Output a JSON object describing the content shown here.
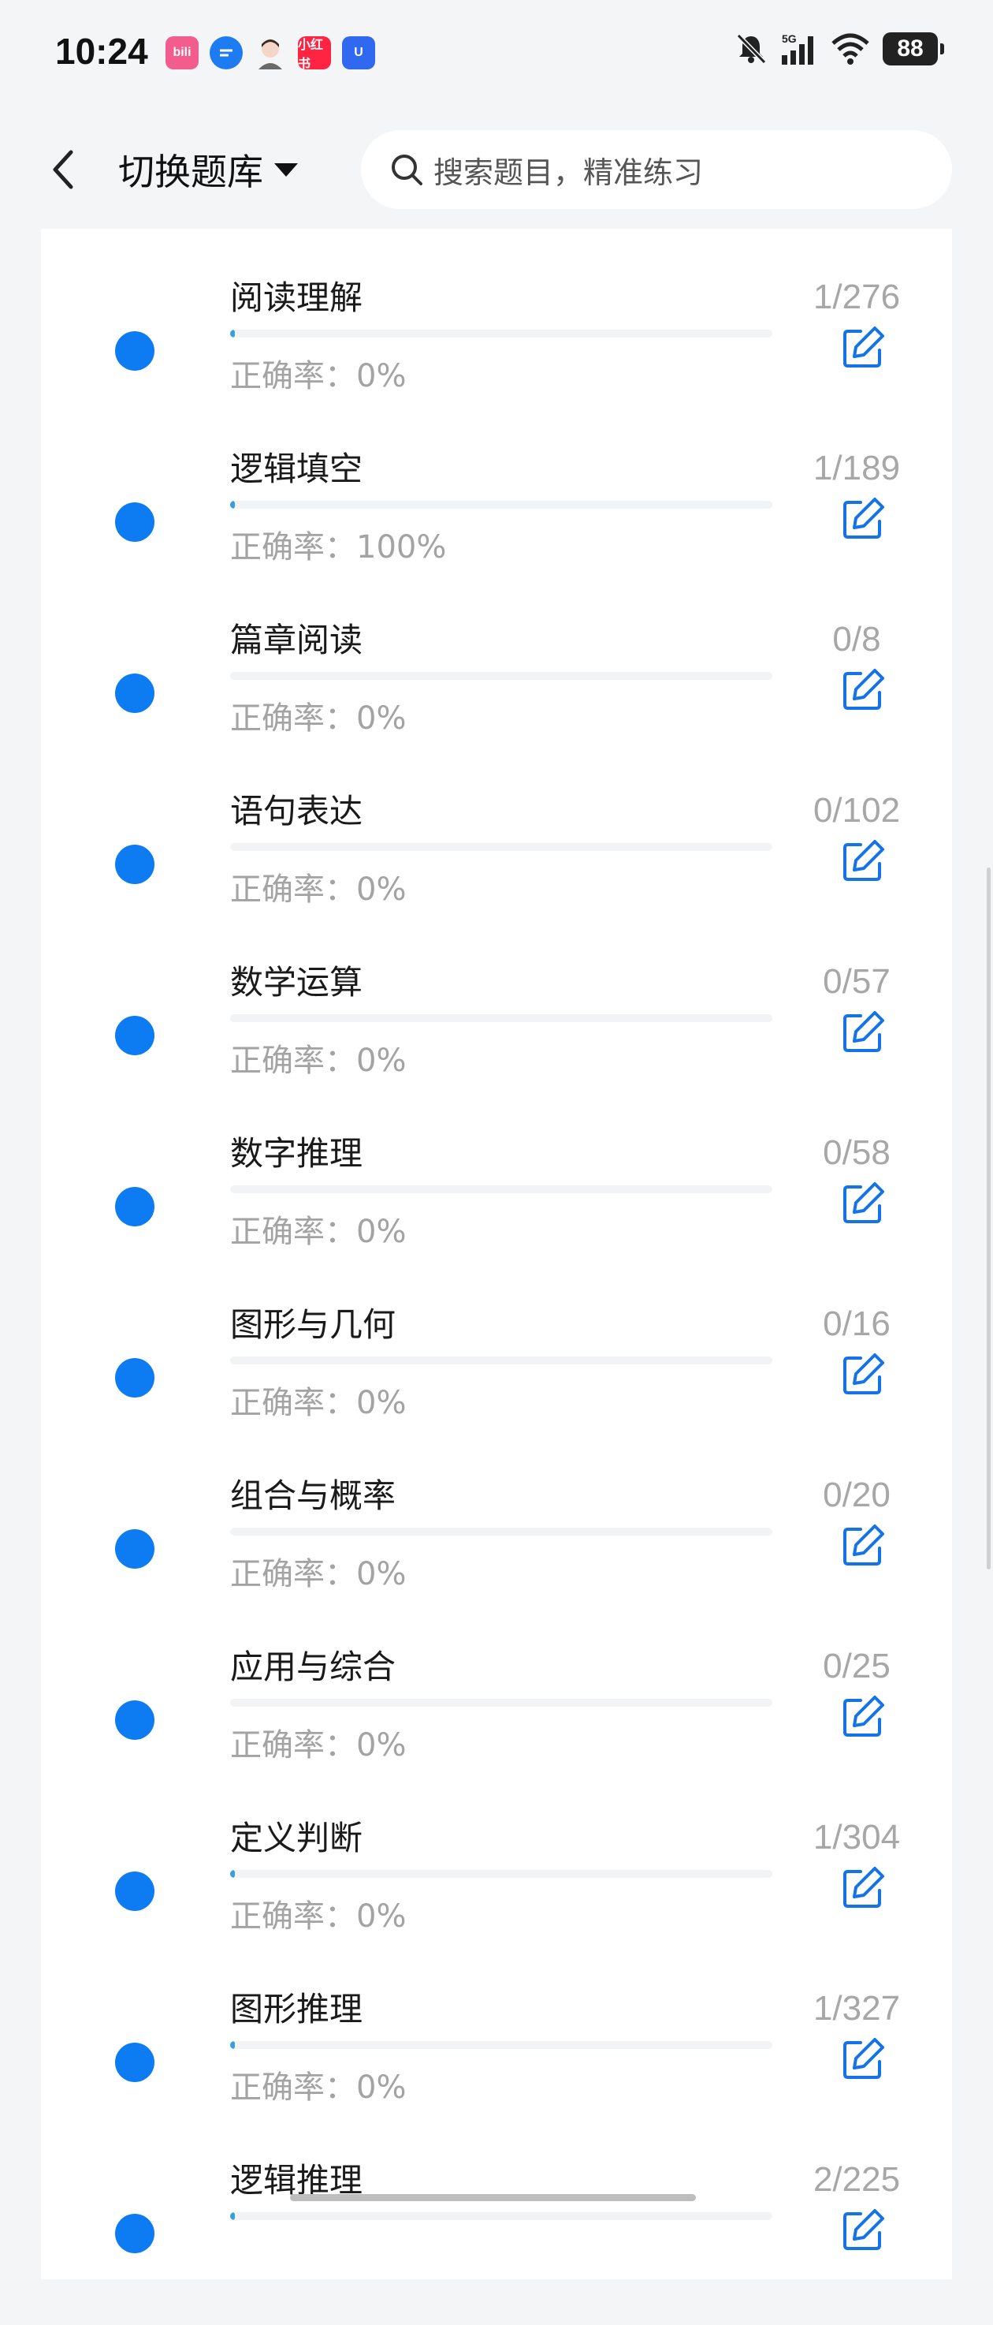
{
  "status_bar": {
    "time": "10:24",
    "apps": [
      {
        "name": "bilibili-icon",
        "label": "bili",
        "color": "#f25d8e"
      },
      {
        "name": "message-icon",
        "label": "",
        "color": "#1e7cf2"
      },
      {
        "name": "avatar-app-icon",
        "label": "",
        "color": "#f4f5f7"
      },
      {
        "name": "xiaohongshu-icon",
        "label": "小红书",
        "color": "#ff2442"
      },
      {
        "name": "vpn-app-icon",
        "label": "U",
        "color": "#3068f0"
      }
    ],
    "network": "5G",
    "battery": "88"
  },
  "header": {
    "title": "切换题库",
    "search_placeholder": "搜索题目，精准练习"
  },
  "categories": [
    {
      "name": "阅读理解",
      "accuracy": "正确率：0%",
      "count": "1/276",
      "progress": 0.0036
    },
    {
      "name": "逻辑填空",
      "accuracy": "正确率：100%",
      "count": "1/189",
      "progress": 0.0053
    },
    {
      "name": "篇章阅读",
      "accuracy": "正确率：0%",
      "count": "0/8",
      "progress": 0
    },
    {
      "name": "语句表达",
      "accuracy": "正确率：0%",
      "count": "0/102",
      "progress": 0
    },
    {
      "name": "数学运算",
      "accuracy": "正确率：0%",
      "count": "0/57",
      "progress": 0
    },
    {
      "name": "数字推理",
      "accuracy": "正确率：0%",
      "count": "0/58",
      "progress": 0
    },
    {
      "name": "图形与几何",
      "accuracy": "正确率：0%",
      "count": "0/16",
      "progress": 0
    },
    {
      "name": "组合与概率",
      "accuracy": "正确率：0%",
      "count": "0/20",
      "progress": 0
    },
    {
      "name": "应用与综合",
      "accuracy": "正确率：0%",
      "count": "0/25",
      "progress": 0
    },
    {
      "name": "定义判断",
      "accuracy": "正确率：0%",
      "count": "1/304",
      "progress": 0.0033
    },
    {
      "name": "图形推理",
      "accuracy": "正确率：0%",
      "count": "1/327",
      "progress": 0.0031
    },
    {
      "name": "逻辑推理",
      "accuracy": "",
      "count": "2/225",
      "progress": 0.0089
    }
  ],
  "colors": {
    "accent": "#0d7cf3",
    "progress_fill": "#37a0dc",
    "muted_text": "#a7a7a7"
  }
}
